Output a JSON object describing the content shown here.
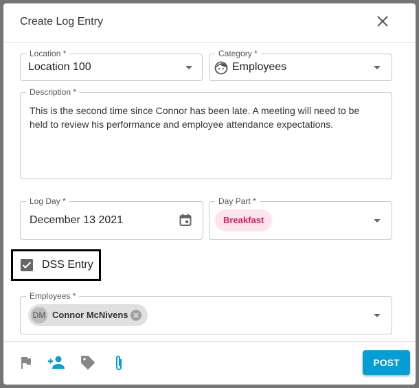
{
  "dialog": {
    "title": "Create Log Entry"
  },
  "location": {
    "label": "Location *",
    "value": "Location 100"
  },
  "category": {
    "label": "Category *",
    "value": "Employees",
    "icon": "face-icon"
  },
  "description": {
    "label": "Description *",
    "value": "This is the second time since Connor has been late. A meeting will need to be held to review his performance and employee attendance expectations."
  },
  "log_day": {
    "label": "Log Day *",
    "value": "December 13 2021",
    "icon": "calendar-icon"
  },
  "day_part": {
    "label": "Day Part *",
    "value": "Breakfast"
  },
  "dss": {
    "label": "DSS Entry",
    "checked": true
  },
  "employees": {
    "label": "Employees *",
    "chips": [
      {
        "initials": "DM",
        "name": "Connor McNivens"
      }
    ]
  },
  "footer": {
    "icons": [
      "flag-icon",
      "add-person-icon",
      "tag-icon",
      "paperclip-icon"
    ],
    "post_label": "POST"
  },
  "colors": {
    "accent": "#039ed6",
    "chip_pink": "#fce4ec",
    "chip_pink_text": "#d81b60"
  }
}
